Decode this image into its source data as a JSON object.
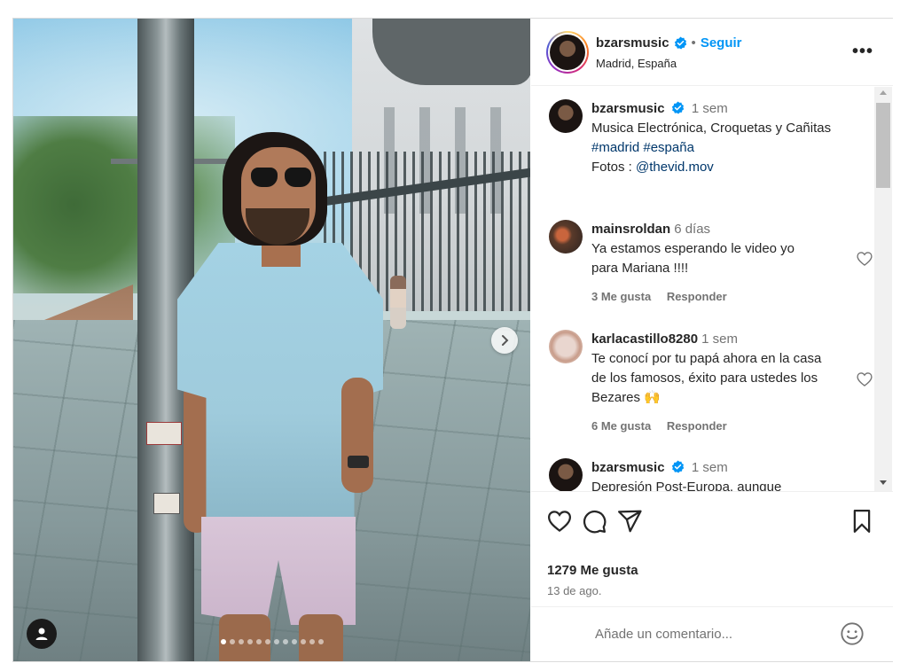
{
  "header": {
    "username": "bzarsmusic",
    "separator": "•",
    "follow_label": "Seguir",
    "location": "Madrid, España",
    "more_label": "•••"
  },
  "photo": {
    "slide_count": 12,
    "active_slide": 1
  },
  "caption": {
    "username": "bzarsmusic",
    "time": "1 sem",
    "line1": "Musica Electrónica, Croquetas y Cañitas",
    "hashtag1": "#madrid",
    "hashtag2": "#españa",
    "fotos_label": "Fotos : ",
    "mention": "@thevid.mov"
  },
  "comments": [
    {
      "username": "mainsroldan",
      "time": "6 días",
      "text": "Ya estamos esperando le video yo para Mariana !!!!",
      "likes": "3 Me gusta",
      "reply": "Responder"
    },
    {
      "username": "karlacastillo8280",
      "time": "1 sem",
      "text": "Te conocí por tu papá ahora en la casa de los famosos, éxito para ustedes los Bezares 🙌",
      "likes": "6 Me gusta",
      "reply": "Responder"
    },
    {
      "username": "bzarsmusic",
      "time": "1 sem",
      "text": "Depresión Post-Europa, aunque extrañe la comida de mexico no"
    }
  ],
  "post": {
    "likes": "1279 Me gusta",
    "date": "13 de ago."
  },
  "add_comment": {
    "placeholder": "Añade un comentario..."
  },
  "colors": {
    "accent": "#0095f6",
    "link": "#00376b",
    "muted": "#737373",
    "verified": "#0095f6"
  }
}
